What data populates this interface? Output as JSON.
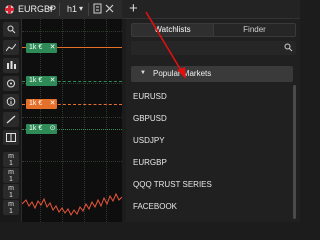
{
  "topbar": {
    "symbol": "EURGBP",
    "timeframe": "h1",
    "add_tab_glyph": "+"
  },
  "chart": {
    "order_badges": [
      {
        "label": "1k",
        "unit": "€",
        "close": "✕",
        "color": "#2e8b57"
      },
      {
        "label": "1k",
        "unit": "€",
        "close": "✕",
        "color": "#2e8b57"
      },
      {
        "label": "1k",
        "unit": "€",
        "close": "✕",
        "color": "#e4702a"
      },
      {
        "label": "1k",
        "unit": "€",
        "close": "⊙",
        "color": "#2e8b57"
      }
    ],
    "line_colors": {
      "position": "#e4702a",
      "order": "#2e8b57"
    },
    "price_color": "#e8553a"
  },
  "lefttools": {
    "items": [
      "search-icon",
      "chart-icon",
      "chart-type-icon",
      "indicator-icon",
      "info-icon",
      "drawing-icon",
      "layout-icon",
      "m1",
      "m1",
      "m1",
      "m1",
      "m1",
      "m1"
    ],
    "labels": {
      "m1_label": "m",
      "m1_sub": "1"
    }
  },
  "panel": {
    "tabs": {
      "watchlists": "Watchlists",
      "finder": "Finder"
    },
    "search": {
      "placeholder": ""
    },
    "section": {
      "label": "Popular Markets",
      "icon": "triangle-down"
    },
    "markets": [
      "EURUSD",
      "GBPUSD",
      "USDJPY",
      "EURGBP",
      "QQQ TRUST SERIES",
      "FACEBOOK"
    ]
  },
  "annotation": {
    "arrow_color": "#e01010"
  }
}
